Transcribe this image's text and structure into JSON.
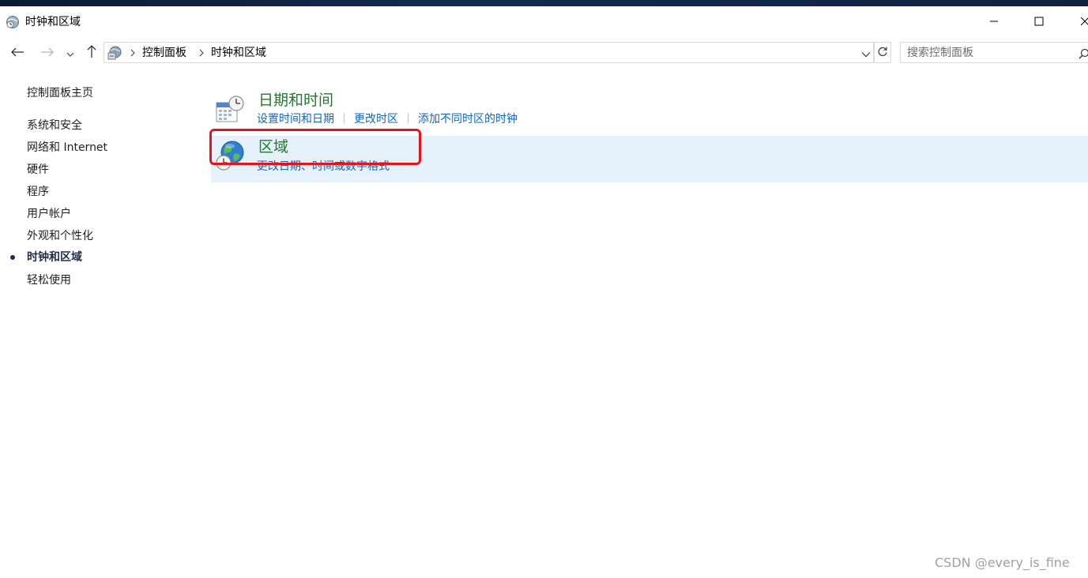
{
  "window": {
    "title": "时钟和区域",
    "icons": {
      "app": "clock-globe-icon",
      "minimize": "minimize-icon",
      "maximize": "maximize-icon",
      "close": "close-icon"
    }
  },
  "nav": {
    "icons": [
      "back-arrow-icon",
      "forward-arrow-icon",
      "recent-dropdown-icon",
      "up-arrow-icon"
    ]
  },
  "address": {
    "breadcrumbs": [
      "控制面板",
      "时钟和区域"
    ],
    "icons": {
      "location": "control-panel-icon",
      "dropdown": "chevron-down-icon",
      "refresh": "refresh-icon"
    }
  },
  "search": {
    "placeholder": "搜索控制面板",
    "value": "",
    "icon": "search-icon"
  },
  "sidebar": {
    "home": "控制面板主页",
    "items": [
      {
        "label": "系统和安全",
        "active": false
      },
      {
        "label": "网络和 Internet",
        "active": false
      },
      {
        "label": "硬件",
        "active": false
      },
      {
        "label": "程序",
        "active": false
      },
      {
        "label": "用户帐户",
        "active": false
      },
      {
        "label": "外观和个性化",
        "active": false
      },
      {
        "label": "时钟和区域",
        "active": true
      },
      {
        "label": "轻松使用",
        "active": false
      }
    ]
  },
  "categories": [
    {
      "title": "日期和时间",
      "icon": "calendar-clock-icon",
      "links": [
        "设置时间和日期",
        "更改时区",
        "添加不同时区的时钟"
      ],
      "highlighted": false
    },
    {
      "title": "区域",
      "icon": "globe-clock-icon",
      "links": [
        "更改日期、时间或数字格式"
      ],
      "highlighted": true
    }
  ],
  "annotation": {
    "color": "#e8131a",
    "target": "区域"
  },
  "colors": {
    "category_title": "#1e7b28",
    "link": "#0f67c0",
    "highlight_bg": "#e5f1fb",
    "active_nav": "#1e2b4a"
  },
  "watermark": "CSDN @every_is_fine"
}
